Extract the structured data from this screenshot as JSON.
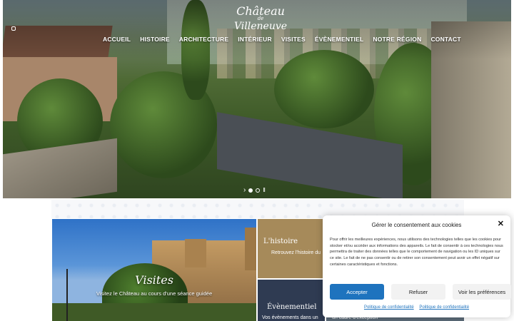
{
  "logo": {
    "line1": "Château",
    "line2": "de",
    "line3": "Villeneuve"
  },
  "nav": {
    "items": [
      "ACCUEIL",
      "HISTOIRE",
      "ARCHITECTURE",
      "INTÉRIEUR",
      "VISITES",
      "ÉVÈNEMENTIEL",
      "NOTRE RÉGION",
      "CONTACT"
    ]
  },
  "slider": {
    "arrow": "›",
    "pause": "II",
    "slides": 2,
    "current": 1
  },
  "tiles": {
    "visit": {
      "title": "Visites",
      "subtitle": "Visitez le Château au cours d'une séance guidée"
    },
    "history": {
      "title": "L'histoire",
      "subtitle": "Retrouvez l'histoire du"
    },
    "event": {
      "title": "Évènementiel",
      "subtitle": "Vos évènements dans un"
    },
    "right": {
      "subtitle": "un cadre d'exception"
    }
  },
  "cookie": {
    "title": "Gérer le consentement aux cookies",
    "body": "Pour offrir les meilleures expériences, nous utilisons des technologies telles que les cookies pour stocker et/ou accéder aux informations des appareils. Le fait de consentir à ces technologies nous permettra de traiter des données telles que le comportement de navigation ou les ID uniques sur ce site. Le fait de ne pas consentir ou de retirer son consentement peut avoir un effet négatif sur certaines caractéristiques et fonctions.",
    "accept": "Accepter",
    "refuse": "Refuser",
    "prefs": "Voir les préférences",
    "link1": "Politique de confidentialité",
    "link2": "Politique de confidentialité",
    "close": "✕"
  },
  "colors": {
    "accent": "#1e73be",
    "history_tile": "#a68a5a",
    "event_tile": "#2f3b52"
  }
}
